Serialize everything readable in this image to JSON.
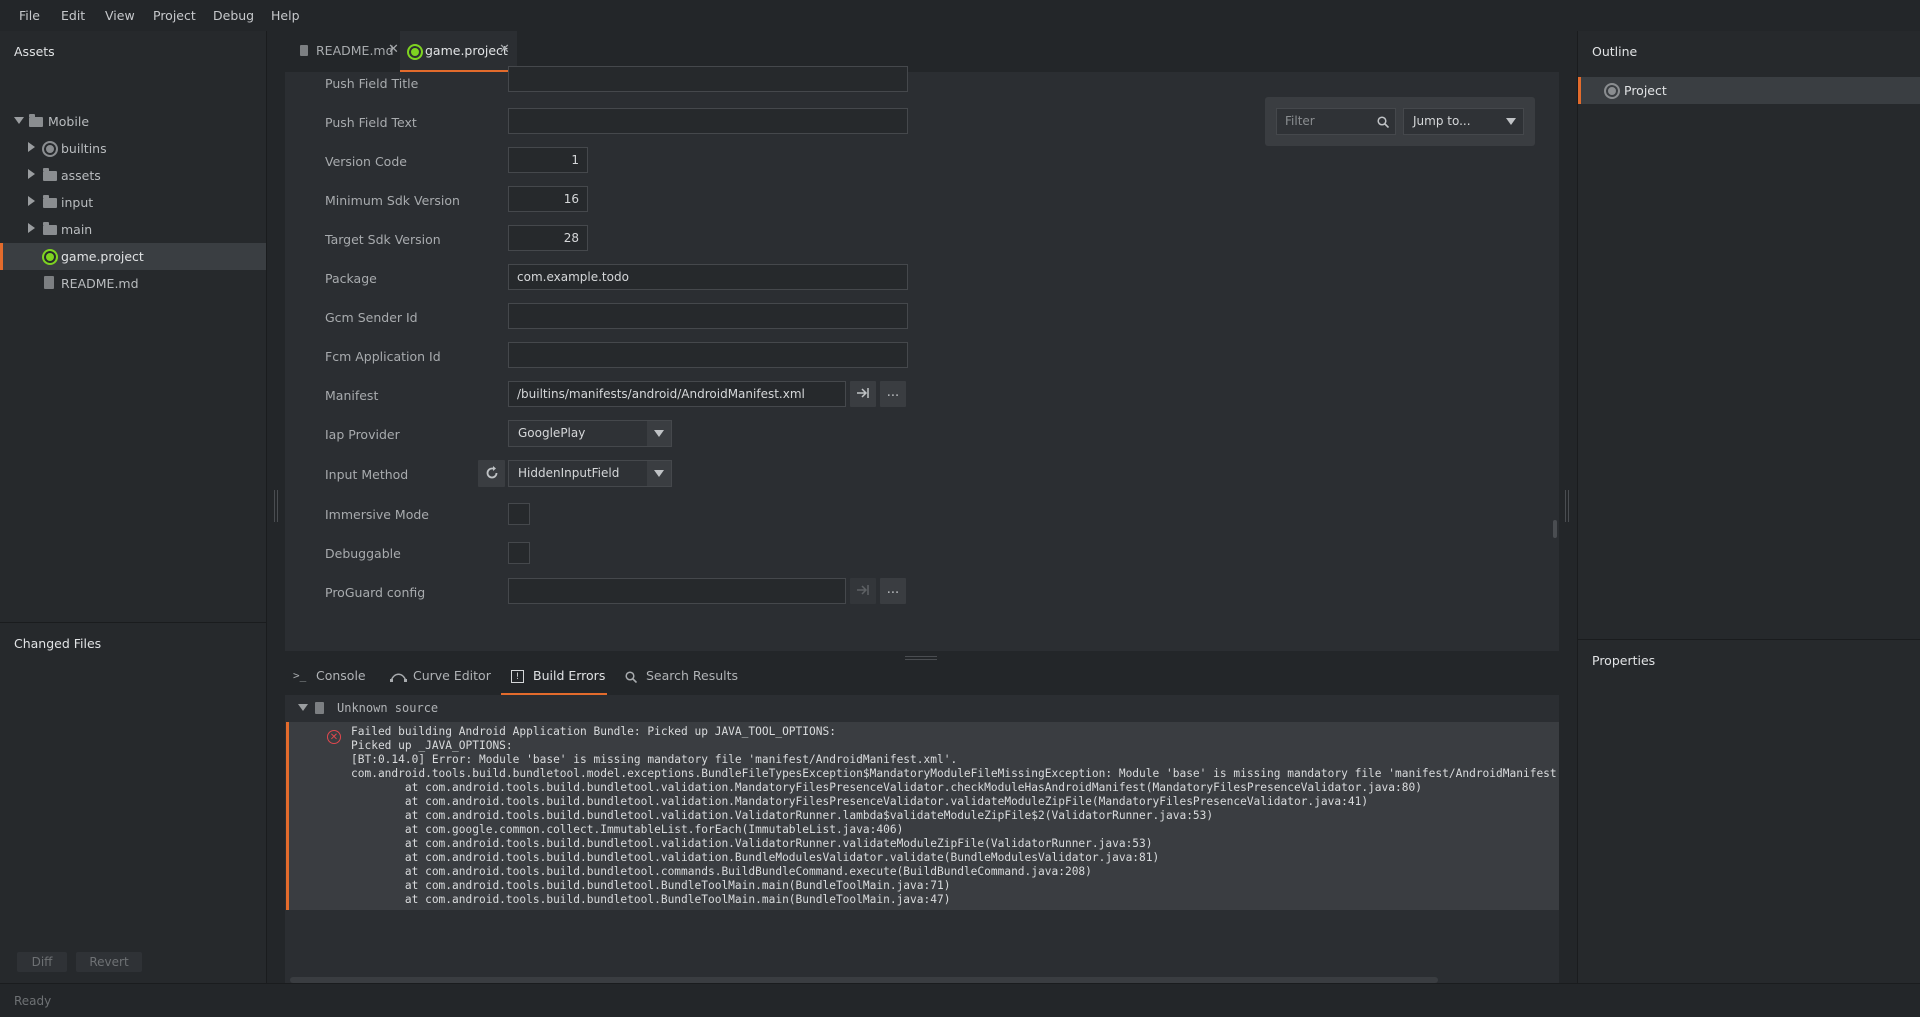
{
  "menu": [
    "File",
    "Edit",
    "View",
    "Project",
    "Debug",
    "Help"
  ],
  "assets": {
    "title": "Assets",
    "tree": [
      {
        "label": "Mobile"
      },
      {
        "label": "builtins"
      },
      {
        "label": "assets"
      },
      {
        "label": "input"
      },
      {
        "label": "main"
      },
      {
        "label": "game.project"
      },
      {
        "label": "README.md"
      }
    ]
  },
  "changed_files": {
    "title": "Changed Files",
    "diff_label": "Diff",
    "revert_label": "Revert"
  },
  "editor": {
    "tabs": [
      {
        "label": "README.md"
      },
      {
        "label": "game.project"
      }
    ],
    "close_glyph": "✕",
    "filter_placeholder": "Filter",
    "jump_label": "Jump to...",
    "fields": {
      "push_field_title": {
        "label": "Push Field Title",
        "value": ""
      },
      "push_field_text": {
        "label": "Push Field Text",
        "value": ""
      },
      "version_code": {
        "label": "Version Code",
        "value": "1"
      },
      "min_sdk": {
        "label": "Minimum Sdk Version",
        "value": "16"
      },
      "target_sdk": {
        "label": "Target Sdk Version",
        "value": "28"
      },
      "package": {
        "label": "Package",
        "value": "com.example.todo"
      },
      "gcm_sender_id": {
        "label": "Gcm Sender Id",
        "value": ""
      },
      "fcm_app_id": {
        "label": "Fcm Application Id",
        "value": ""
      },
      "manifest": {
        "label": "Manifest",
        "value": "/builtins/manifests/android/AndroidManifest.xml"
      },
      "iap_provider": {
        "label": "Iap Provider",
        "value": "GooglePlay"
      },
      "input_method": {
        "label": "Input Method",
        "value": "HiddenInputField"
      },
      "immersive_mode": {
        "label": "Immersive Mode",
        "checked": false
      },
      "debuggable": {
        "label": "Debuggable",
        "checked": false
      },
      "proguard": {
        "label": "ProGuard config",
        "value": ""
      }
    },
    "ellipsis": "..."
  },
  "bottom": {
    "tabs": [
      {
        "label": "Console"
      },
      {
        "label": "Curve Editor"
      },
      {
        "label": "Build Errors"
      },
      {
        "label": "Search Results"
      }
    ],
    "source_label": "Unknown source",
    "error_lines": [
      "Failed building Android Application Bundle: Picked up JAVA_TOOL_OPTIONS:",
      "Picked up _JAVA_OPTIONS:",
      "[BT:0.14.0] Error: Module 'base' is missing mandatory file 'manifest/AndroidManifest.xml'.",
      "com.android.tools.build.bundletool.model.exceptions.BundleFileTypesException$MandatoryModuleFileMissingException: Module 'base' is missing mandatory file 'manifest/AndroidManifest.xml'.",
      "        at com.android.tools.build.bundletool.validation.MandatoryFilesPresenceValidator.checkModuleHasAndroidManifest(MandatoryFilesPresenceValidator.java:80)",
      "        at com.android.tools.build.bundletool.validation.MandatoryFilesPresenceValidator.validateModuleZipFile(MandatoryFilesPresenceValidator.java:41)",
      "        at com.android.tools.build.bundletool.validation.ValidatorRunner.lambda$validateModuleZipFile$2(ValidatorRunner.java:53)",
      "        at com.google.common.collect.ImmutableList.forEach(ImmutableList.java:406)",
      "        at com.android.tools.build.bundletool.validation.ValidatorRunner.validateModuleZipFile(ValidatorRunner.java:53)",
      "        at com.android.tools.build.bundletool.validation.BundleModulesValidator.validate(BundleModulesValidator.java:81)",
      "        at com.android.tools.build.bundletool.commands.BuildBundleCommand.execute(BuildBundleCommand.java:208)",
      "        at com.android.tools.build.bundletool.BundleToolMain.main(BundleToolMain.java:71)",
      "        at com.android.tools.build.bundletool.BundleToolMain.main(BundleToolMain.java:47)"
    ]
  },
  "outline": {
    "title": "Outline",
    "item": "Project"
  },
  "properties": {
    "title": "Properties"
  },
  "status": "Ready",
  "colors": {
    "accent": "#e36b2c",
    "project_icon": "#7ed321",
    "error": "#e0484e"
  }
}
